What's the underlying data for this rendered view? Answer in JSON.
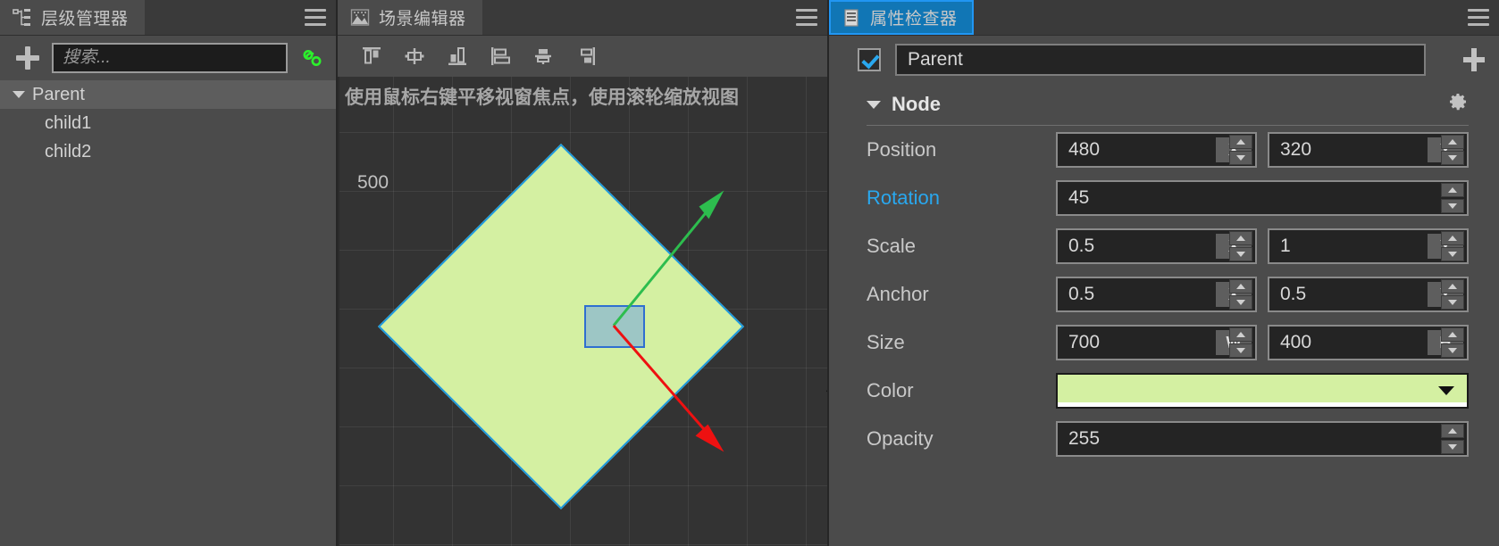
{
  "hierarchy": {
    "tab_label": "层级管理器",
    "tab_icon": "hierarchy-tree-icon",
    "menu_icon": "hamburger-menu-icon",
    "add_button_icon": "plus-icon",
    "link_button_icon": "link-chain-icon",
    "search_placeholder": "搜索...",
    "search_value": "",
    "items": [
      {
        "label": "Parent",
        "depth": 0,
        "expanded": true,
        "selected": true
      },
      {
        "label": "child1",
        "depth": 1,
        "expanded": false,
        "selected": false
      },
      {
        "label": "child2",
        "depth": 1,
        "expanded": false,
        "selected": false
      }
    ]
  },
  "scene": {
    "tab_label": "场景编辑器",
    "tab_icon": "scene-image-icon",
    "menu_icon": "hamburger-menu-icon",
    "align_tools": [
      {
        "name": "align-top",
        "icon": "align-top-icon"
      },
      {
        "name": "align-center-horizontal",
        "icon": "align-center-horizontal-icon"
      },
      {
        "name": "align-bottom",
        "icon": "align-bottom-icon"
      },
      {
        "name": "align-left",
        "icon": "align-left-icon"
      },
      {
        "name": "align-center-vertical",
        "icon": "align-center-vertical-icon"
      },
      {
        "name": "align-right",
        "icon": "align-right-icon"
      }
    ],
    "hint_text": "使用鼠标右键平移视窗焦点，使用滚轮缩放视图",
    "axis_label": "500",
    "stage_color": "#d4f0a2",
    "stage_border_color": "#1e9ae0",
    "gizmo_green_color": "#2dbd4e",
    "gizmo_red_color": "#ee1111",
    "selection_fill": "rgba(120,170,220,0.60)",
    "selection_border": "#2f6fd0"
  },
  "inspector": {
    "tab_label": "属性检查器",
    "tab_icon": "inspector-list-icon",
    "tab_active_color": "#1176b5",
    "menu_icon": "hamburger-menu-icon",
    "node_enabled": true,
    "node_name": "Parent",
    "add_component_icon": "plus-icon",
    "section": {
      "title": "Node",
      "expanded": true,
      "settings_icon": "gear-icon"
    },
    "properties": [
      {
        "label": "Position",
        "highlight": false,
        "type": "vec2",
        "x": {
          "value": "480",
          "tag": "X"
        },
        "y": {
          "value": "320",
          "tag": "Y"
        }
      },
      {
        "label": "Rotation",
        "highlight": true,
        "type": "scalar",
        "x": {
          "value": "45",
          "tag": ""
        }
      },
      {
        "label": "Scale",
        "highlight": false,
        "type": "vec2",
        "x": {
          "value": "0.5",
          "tag": "X"
        },
        "y": {
          "value": "1",
          "tag": "Y"
        }
      },
      {
        "label": "Anchor",
        "highlight": false,
        "type": "vec2",
        "x": {
          "value": "0.5",
          "tag": "X"
        },
        "y": {
          "value": "0.5",
          "tag": "Y"
        }
      },
      {
        "label": "Size",
        "highlight": false,
        "type": "vec2",
        "x": {
          "value": "700",
          "tag": "W"
        },
        "y": {
          "value": "400",
          "tag": "H"
        }
      },
      {
        "label": "Color",
        "highlight": false,
        "type": "color",
        "x": {
          "value": "#d4f0a2",
          "tag": ""
        }
      },
      {
        "label": "Opacity",
        "highlight": false,
        "type": "scalar",
        "x": {
          "value": "255",
          "tag": ""
        }
      }
    ]
  }
}
